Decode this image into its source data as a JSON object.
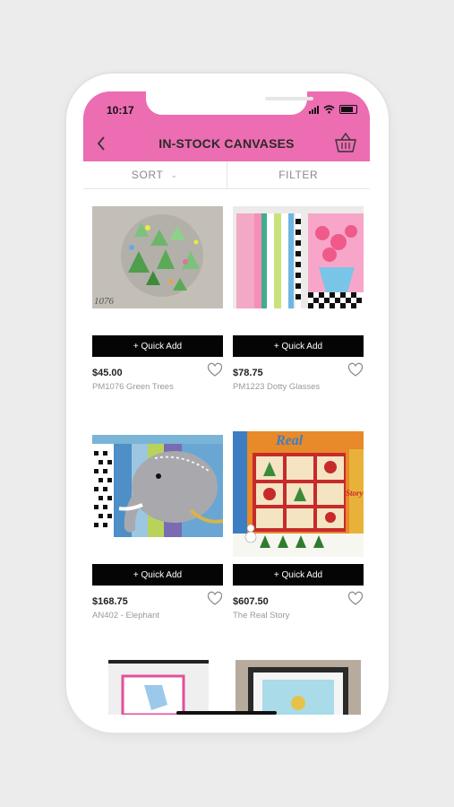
{
  "status": {
    "time": "10:17"
  },
  "header": {
    "title": "IN-STOCK CANVASES"
  },
  "toolbar": {
    "sort_label": "SORT",
    "filter_label": "FILTER"
  },
  "products": [
    {
      "price": "$45.00",
      "name": "PM1076 Green Trees",
      "quick_add": "+ Quick Add",
      "image_text": "1076"
    },
    {
      "price": "$78.75",
      "name": "PM1223 Dotty Glasses",
      "quick_add": "+ Quick Add"
    },
    {
      "price": "$168.75",
      "name": "AN402 - Elephant",
      "quick_add": "+ Quick Add"
    },
    {
      "price": "$607.50",
      "name": "The Real Story",
      "quick_add": "+ Quick Add",
      "image_text": "Real",
      "image_text_2": "Story"
    }
  ],
  "colors": {
    "accent": "#ec6db2",
    "quick_add_bg": "#050505"
  }
}
